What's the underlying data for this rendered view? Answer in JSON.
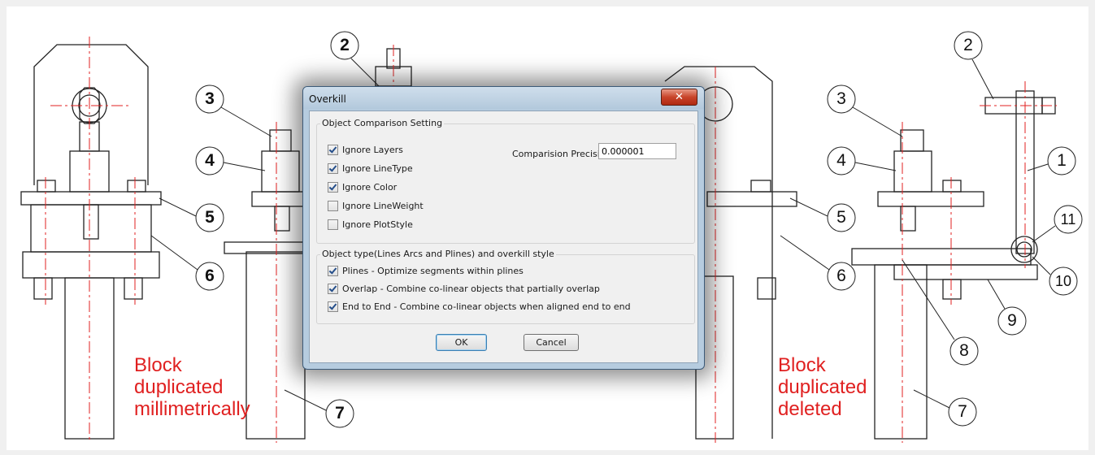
{
  "dialog": {
    "title": "Overkill",
    "close_icon": "close-icon",
    "group_comparison": "Object Comparison Setting",
    "ignore_options": [
      {
        "label": "Ignore Layers",
        "checked": true
      },
      {
        "label": "Ignore LineType",
        "checked": true
      },
      {
        "label": "Ignore Color",
        "checked": true
      },
      {
        "label": "Ignore LineWeight",
        "checked": false
      },
      {
        "label": "Ignore PlotStyle",
        "checked": false
      }
    ],
    "precision_label": "Comparision Precision:",
    "precision_value": "0.000001",
    "group_object_type": "Object type(Lines Arcs and Plines) and overkill style",
    "style_options": [
      {
        "label": "Plines - Optimize segments within plines",
        "checked": true
      },
      {
        "label": "Overlap - Combine co-linear objects that partially overlap",
        "checked": true
      },
      {
        "label": "End to End - Combine co-linear objects when aligned end to end",
        "checked": true
      }
    ],
    "ok_label": "OK",
    "cancel_label": "Cancel"
  },
  "notes": {
    "left": [
      "Block",
      "duplicated",
      "millimetrically"
    ],
    "right": [
      "Block",
      "duplicated",
      "deleted"
    ]
  },
  "callouts": {
    "left": [
      "2",
      "3",
      "4",
      "5",
      "6",
      "7"
    ],
    "right": [
      "2",
      "3",
      "4",
      "5",
      "6",
      "1",
      "11",
      "10",
      "9",
      "8",
      "7"
    ]
  },
  "colors": {
    "annotation": "#e02020",
    "centerline": "#e02020",
    "drawing_line": "#222222",
    "dialog_frame": "#b6ccdf"
  }
}
